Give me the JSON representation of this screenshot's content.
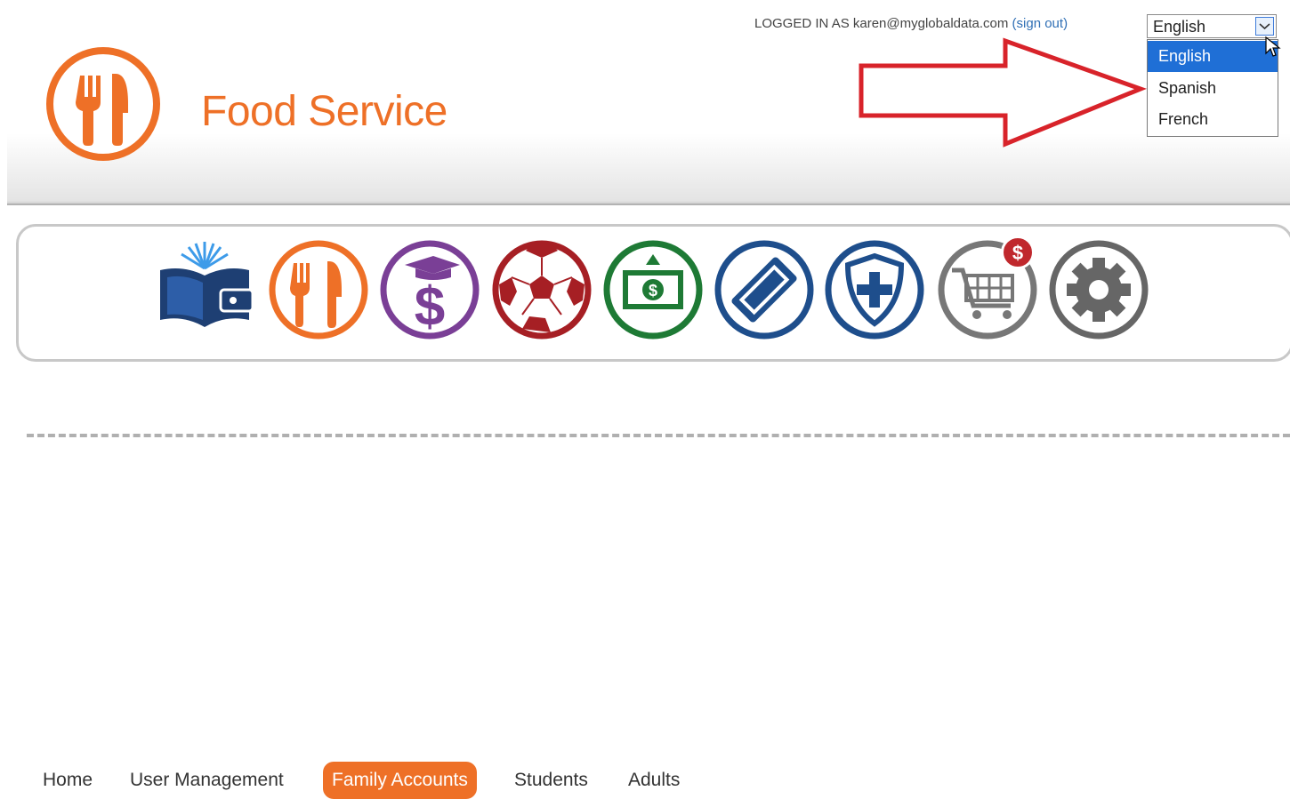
{
  "header": {
    "app_title": "Food Service",
    "logo_icon": "fork-knife-icon",
    "brand_color": "#ee7027"
  },
  "login": {
    "prefix": "LOGGED IN AS karen@myglobaldata.com",
    "sign_out": "(sign out)"
  },
  "language": {
    "selected": "English",
    "options": [
      "English",
      "Spanish",
      "French"
    ]
  },
  "icon_bar": [
    {
      "icon": "open-book-wallet-icon",
      "color": "#1e3f73"
    },
    {
      "icon": "fork-knife-icon",
      "color": "#ee7027"
    },
    {
      "icon": "graduation-dollar-icon",
      "color": "#7a3f96"
    },
    {
      "icon": "soccer-ball-icon",
      "color": "#a61f24"
    },
    {
      "icon": "cash-bill-icon",
      "color": "#1e7a35"
    },
    {
      "icon": "ticket-icon",
      "color": "#1e4e8c"
    },
    {
      "icon": "shield-plus-icon",
      "color": "#1e4e8c"
    },
    {
      "icon": "shopping-cart-icon",
      "color": "#777777",
      "badge": "$"
    },
    {
      "icon": "gear-icon",
      "color": "#666666"
    }
  ],
  "nav": {
    "items": [
      "Home",
      "User Management",
      "Family Accounts",
      "Students",
      "Adults"
    ],
    "active": "Family Accounts"
  }
}
